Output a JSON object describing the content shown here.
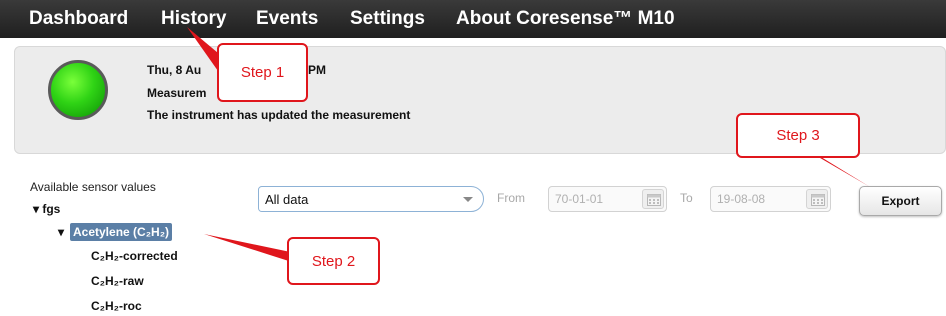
{
  "nav": {
    "dashboard": "Dashboard",
    "history": "History",
    "events": "Events",
    "settings": "Settings",
    "about": "About Coresense™ M10"
  },
  "status": {
    "line1": "Thu, 8 Au",
    "line1_end": "PM",
    "line2": "Measurem",
    "line3": "The instrument has updated the measurement",
    "light_color": "#2fd315"
  },
  "annotations": {
    "step1": "Step 1",
    "step2": "Step 2",
    "step3": "Step 3",
    "color": "#e0161c"
  },
  "sensors": {
    "label": "Available sensor values",
    "root": "fgs",
    "selected": "Acetylene (C₂H₂)",
    "children": [
      "C₂H₂-corrected",
      "C₂H₂-raw",
      "C₂H₂-roc"
    ]
  },
  "filter": {
    "range_select": "All data",
    "from_label": "From",
    "from_value": "70-01-01",
    "to_label": "To",
    "to_value": "19-08-08",
    "export_label": "Export"
  }
}
